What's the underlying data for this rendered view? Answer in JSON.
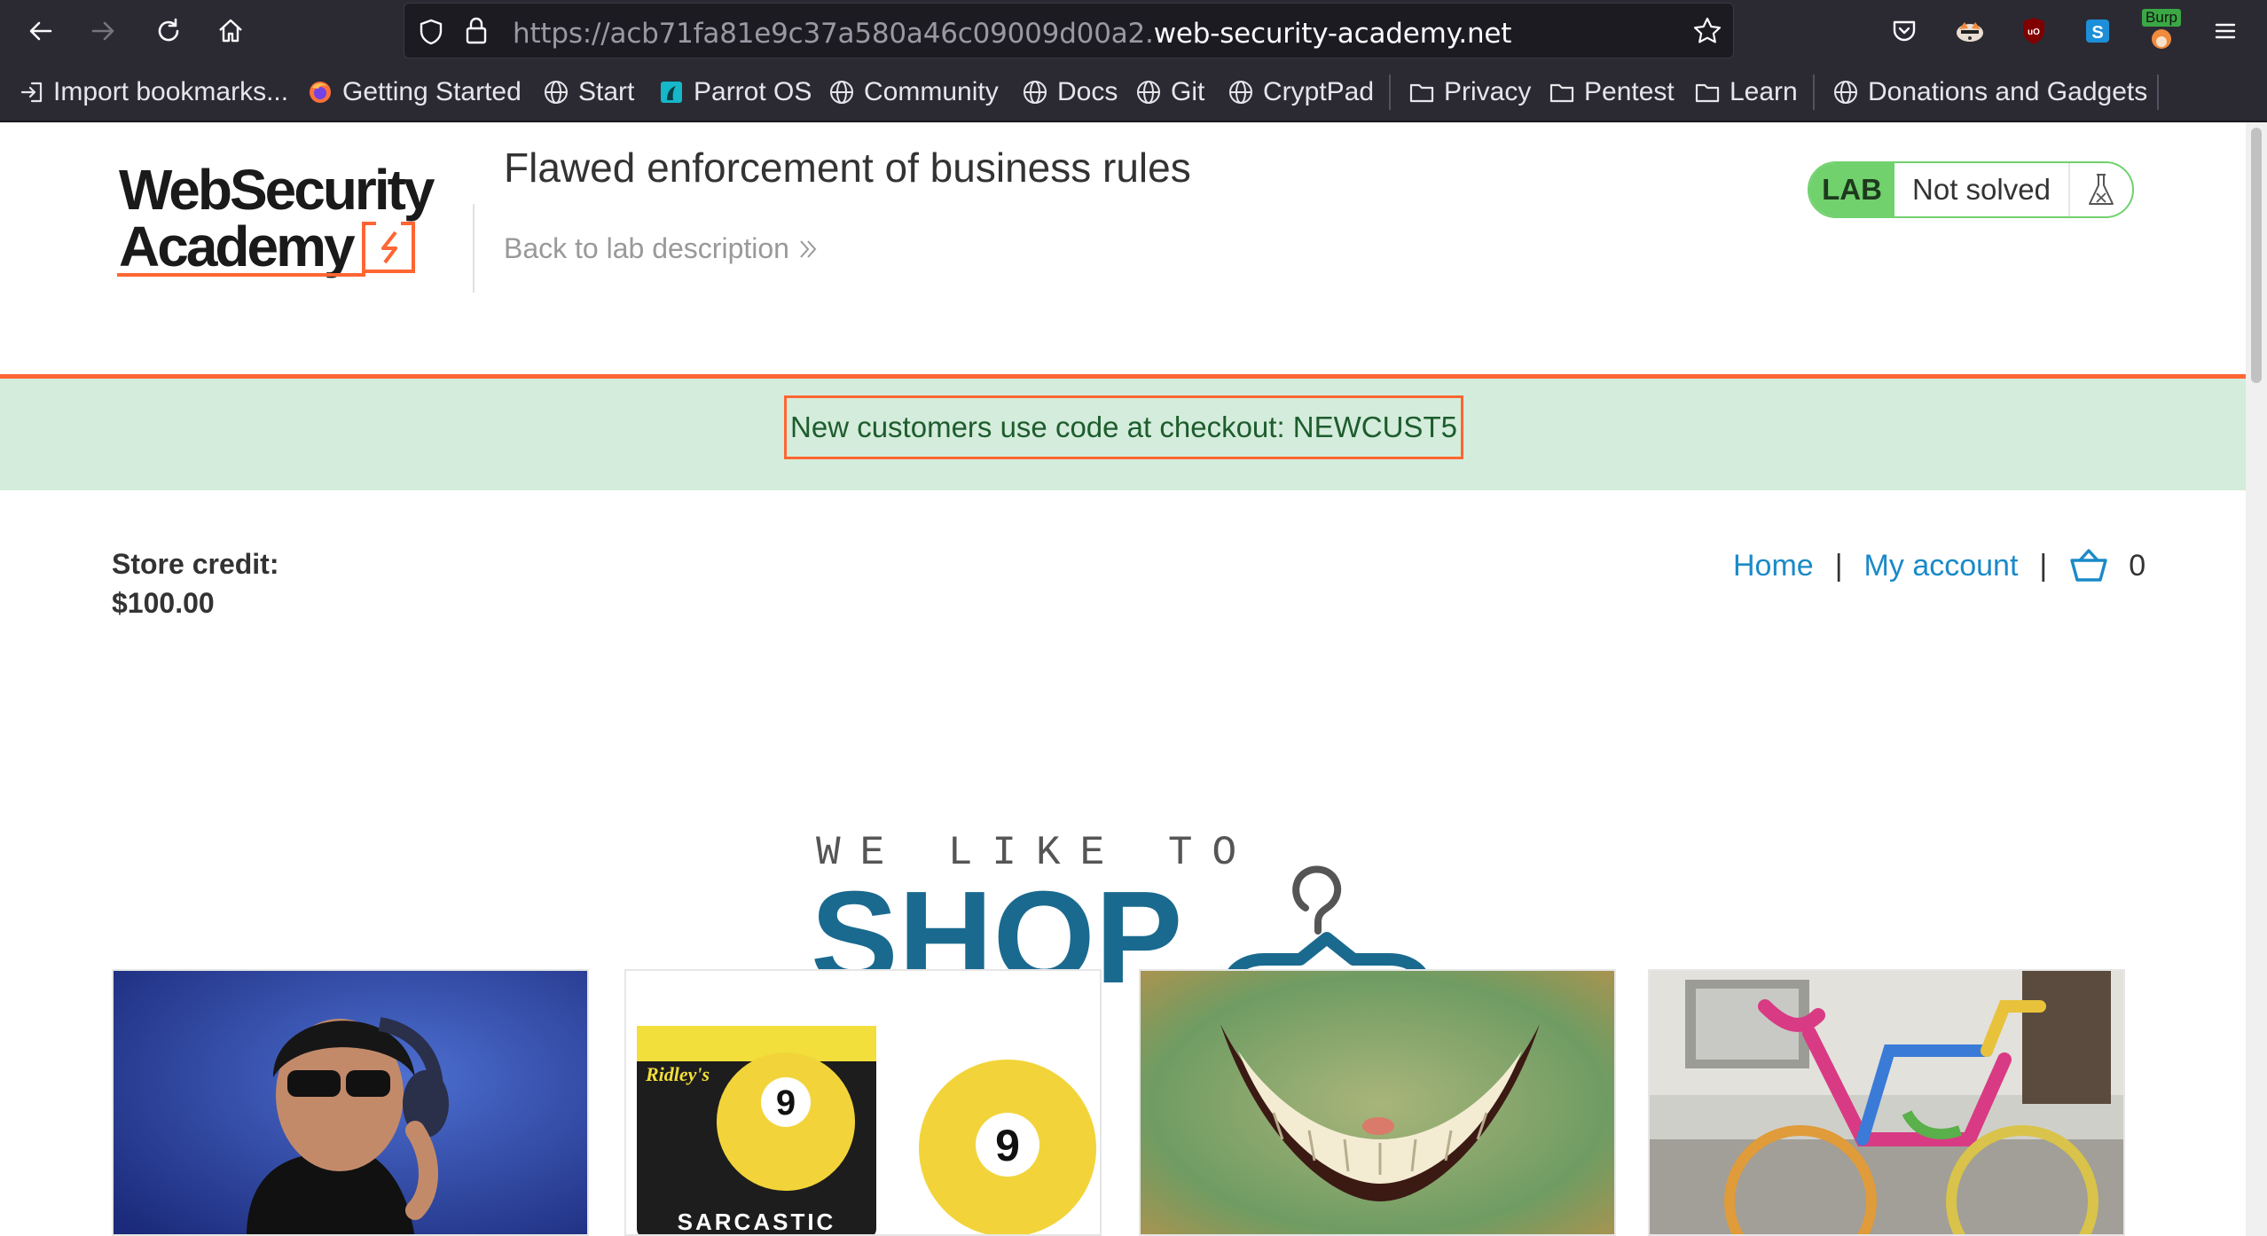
{
  "browser": {
    "url_prefix": "https://acb71fa81e9c37a580a46c09009d00a2.",
    "url_domain": "web-security-academy.net",
    "extension_badge": "Burp"
  },
  "bookmarks": [
    {
      "label": "Import bookmarks...",
      "icon": "import-icon"
    },
    {
      "label": "Getting Started",
      "icon": "firefox-icon"
    },
    {
      "label": "Start",
      "icon": "globe-icon"
    },
    {
      "label": "Parrot OS",
      "icon": "parrot-icon"
    },
    {
      "label": "Community",
      "icon": "globe-icon"
    },
    {
      "label": "Docs",
      "icon": "globe-icon"
    },
    {
      "label": "Git",
      "icon": "globe-icon"
    },
    {
      "label": "CryptPad",
      "icon": "globe-icon"
    },
    {
      "label": "Privacy",
      "icon": "folder-icon"
    },
    {
      "label": "Pentest",
      "icon": "folder-icon"
    },
    {
      "label": "Learn",
      "icon": "folder-icon"
    },
    {
      "label": "Donations and Gadgets",
      "icon": "globe-icon"
    }
  ],
  "lab": {
    "logo_line1": "WebSecurity",
    "logo_line2": "Academy",
    "title": "Flawed enforcement of business rules",
    "back_link": "Back to lab description",
    "badge": "LAB",
    "status": "Not solved"
  },
  "notice": "New customers use code at checkout: NEWCUST5",
  "store": {
    "credit_label": "Store credit:",
    "credit_value": "$100.00"
  },
  "nav": {
    "home": "Home",
    "separator": "|",
    "my_account": "My account",
    "cart_count": "0"
  },
  "banner": {
    "tagline": "WE LIKE TO",
    "word": "SHOP"
  },
  "products": [
    {
      "name": "product-headphones-image"
    },
    {
      "name": "product-8-ball-image",
      "box_brand": "Ridley's",
      "box_text": "SARCASTIC",
      "ball_number": "9"
    },
    {
      "name": "product-grin-image"
    },
    {
      "name": "product-knitted-bike-image"
    }
  ],
  "colors": {
    "accent_orange": "#ff6633",
    "lab_green": "#70d16d",
    "link_blue": "#1a8ac8",
    "notice_bg": "#d4ecdb",
    "shop_blue": "#1a6a8f"
  }
}
